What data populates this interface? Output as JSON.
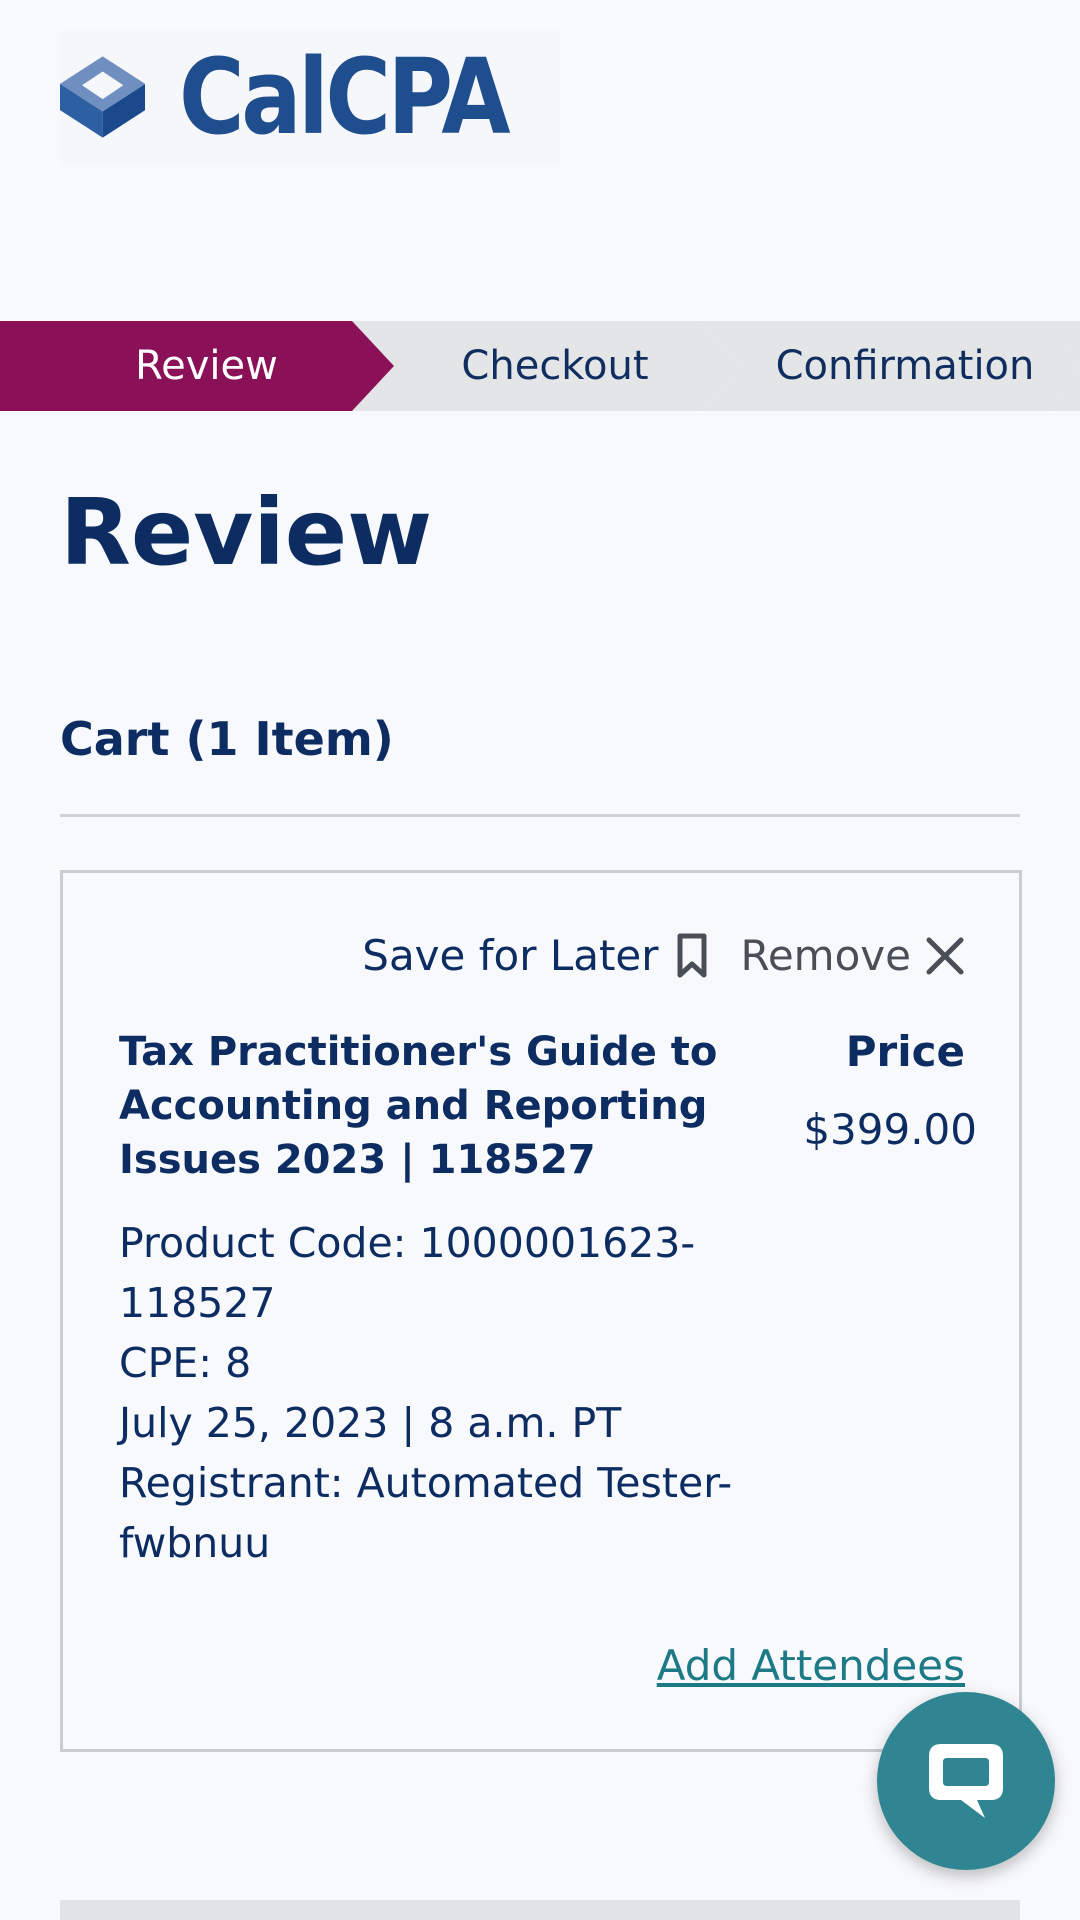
{
  "brand": {
    "logo_text": "CalCPA",
    "logo_icon": "calcpa-cube-logo",
    "primary_color": "#1f4e8e",
    "accent_color": "#8a1157"
  },
  "steps": [
    {
      "label": "Review",
      "active": true
    },
    {
      "label": "Checkout",
      "active": false
    },
    {
      "label": "Confirmation",
      "active": false
    }
  ],
  "page_title": "Review",
  "cart": {
    "title": "Cart (1 Item)",
    "item": {
      "save_later_label": "Save for Later",
      "save_later_icon": "bookmark-icon",
      "remove_label": "Remove",
      "remove_icon": "close-icon",
      "title": "Tax Practitioner's Guide to Accounting and Reporting Issues 2023 | 118527",
      "price_label": "Price",
      "price": "$399.00",
      "product_code": "Product Code: 1000001623-118527",
      "cpe": "CPE: 8",
      "date": "July 25, 2023 | 8 a.m. PT",
      "registrant": "Registrant: Automated Tester-fwbnuu",
      "add_attendees_label": "Add Attendees"
    }
  },
  "chat": {
    "icon": "chat-bubble-icon",
    "color": "#2f8592"
  }
}
